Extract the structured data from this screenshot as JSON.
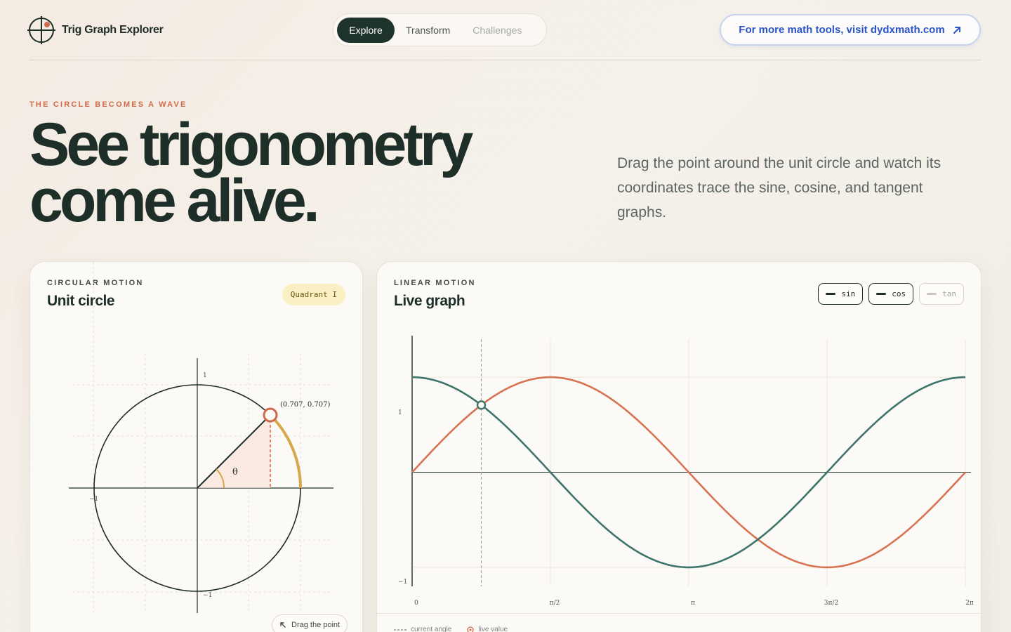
{
  "app": {
    "name": "Trig Graph Explorer"
  },
  "nav": {
    "tabs": [
      {
        "label": "Explore",
        "state": "active"
      },
      {
        "label": "Transform",
        "state": "normal"
      },
      {
        "label": "Challenges",
        "state": "muted"
      }
    ],
    "external_link": {
      "label": "For more math tools, visit dydxmath.com",
      "icon": "arrow-up-right-icon"
    }
  },
  "hero": {
    "eyebrow": "THE CIRCLE BECOMES A WAVE",
    "headline_line1": "See trigonometry",
    "headline_line2": "come alive.",
    "lede": "Drag the point around the unit circle and watch its coordinates trace the sine, cosine, and tangent graphs."
  },
  "unit_circle_card": {
    "kicker": "CIRCULAR MOTION",
    "title": "Unit circle",
    "badge": "Quadrant I",
    "point_label": "(0.707, 0.707)",
    "angle_symbol": "θ",
    "axis_labels": {
      "top": "1",
      "left": "−1",
      "bottom": "−1"
    },
    "drag_hint": "Drag the point",
    "colors": {
      "point": "#d0694a",
      "arc": "#d7a84a",
      "circle": "#1f2d28"
    }
  },
  "graph_card": {
    "kicker": "LINEAR MOTION",
    "title": "Live graph",
    "toggles": [
      {
        "label": "sin",
        "on": true
      },
      {
        "label": "cos",
        "on": true
      },
      {
        "label": "tan",
        "on": false
      }
    ],
    "legend": [
      {
        "label": "current angle",
        "icon": "dashed-line-icon"
      },
      {
        "label": "live value",
        "icon": "target-dot-icon"
      }
    ]
  },
  "chart_data": {
    "type": "line",
    "x_tick_labels": [
      "0",
      "π/2",
      "π",
      "3π/2",
      "2π"
    ],
    "y_tick_labels": [
      "1",
      "−1"
    ],
    "xlim": [
      0,
      6.2832
    ],
    "ylim": [
      -1.2,
      1.4
    ],
    "current_angle": 0.7854,
    "series": [
      {
        "name": "sin",
        "color": "#d87352",
        "function": "sin(x)"
      },
      {
        "name": "cos",
        "color": "#3d746b",
        "function": "cos(x)"
      }
    ]
  }
}
